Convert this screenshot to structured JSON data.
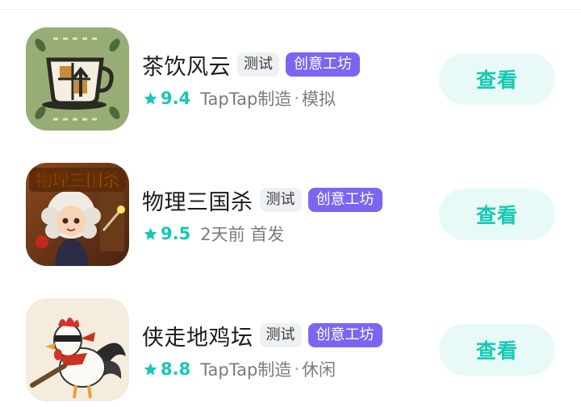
{
  "colors": {
    "accent": "#14c9b3",
    "creative_tag": "#7b66f2",
    "button_bg": "#e8faf7"
  },
  "games": [
    {
      "title": "茶饮风云",
      "tags": [
        "测试",
        "创意工坊"
      ],
      "rating": "9.4",
      "meta": "TapTap制造",
      "meta_sep": "·",
      "category": "模拟",
      "button": "查看",
      "icon": "tea-cup-icon"
    },
    {
      "title": "物理三国杀",
      "tags": [
        "测试",
        "创意工坊"
      ],
      "rating": "9.5",
      "meta": "2天前 首发",
      "meta_sep": "",
      "category": "",
      "button": "查看",
      "icon": "physics-scientist-icon",
      "icon_text": "物理三国杀"
    },
    {
      "title": "侠走地鸡坛",
      "tags": [
        "测试",
        "创意工坊"
      ],
      "rating": "8.8",
      "meta": "TapTap制造",
      "meta_sep": "·",
      "category": "休闲",
      "button": "查看",
      "icon": "ninja-rooster-icon"
    }
  ]
}
